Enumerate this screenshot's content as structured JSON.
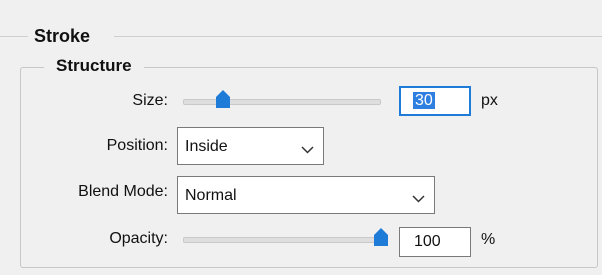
{
  "stroke": {
    "title": "Stroke"
  },
  "structure": {
    "title": "Structure",
    "size": {
      "label": "Size:",
      "value": "30",
      "unit": "px",
      "slider_fraction": 0.2
    },
    "position": {
      "label": "Position:",
      "value": "Inside"
    },
    "blend_mode": {
      "label": "Blend Mode:",
      "value": "Normal"
    },
    "opacity": {
      "label": "Opacity:",
      "value": "100",
      "unit": "%",
      "slider_fraction": 1.0
    }
  },
  "colors": {
    "accent": "#1e7bd8",
    "selection": "#2f7fe0",
    "background": "#f0f0f0"
  },
  "icons": {
    "dropdown": "chevron-down-icon",
    "slider_thumb": "slider-thumb-icon"
  }
}
